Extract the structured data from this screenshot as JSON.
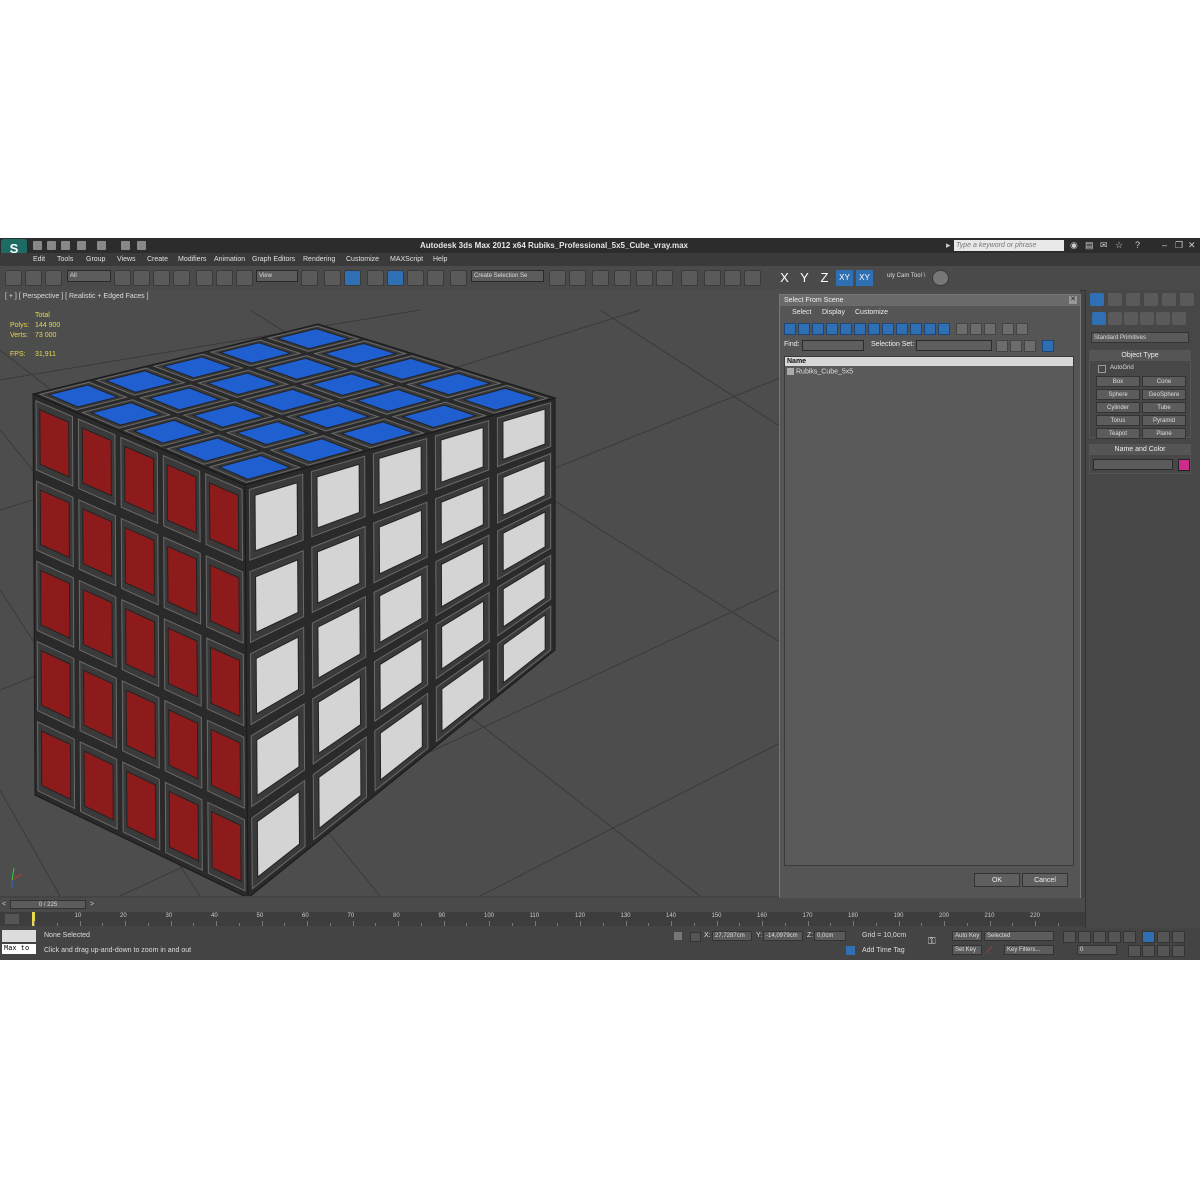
{
  "app": {
    "logo_text": "S",
    "title": "Autodesk 3ds Max  2012 x64     Rubiks_Professional_5x5_Cube_vray.max",
    "search_placeholder": "Type a keyword or phrase"
  },
  "menu": [
    "Edit",
    "Tools",
    "Group",
    "Views",
    "Create",
    "Modifiers",
    "Animation",
    "Graph Editors",
    "Rendering",
    "Customize",
    "MAXScript",
    "Help"
  ],
  "toolbar": {
    "filter_value": "All",
    "ref_coord": "View",
    "selection_set_placeholder": "Create Selection Se",
    "axes": [
      "X",
      "Y",
      "Z",
      "XY",
      "XY"
    ],
    "cam_tool_label": "uty Cam Tool \\"
  },
  "viewport": {
    "label": "[ + ] [ Perspective ] [ Realistic + Edged Faces ]",
    "stats": {
      "total_label": "Total",
      "polys_label": "Polys:",
      "polys_value": "144 900",
      "verts_label": "Verts:",
      "verts_value": "73 000",
      "fps_label": "FPS:",
      "fps_value": "31,911"
    }
  },
  "dialog": {
    "title": "Select From Scene",
    "menu": [
      "Select",
      "Display",
      "Customize"
    ],
    "find_label": "Find:",
    "selection_set_label": "Selection Set:",
    "column_name": "Name",
    "items": [
      "Rubiks_Cube_5x5"
    ],
    "ok_label": "OK",
    "cancel_label": "Cancel"
  },
  "command_panel": {
    "category": "Standard Primitives",
    "object_type_title": "Object Type",
    "autogrid_label": "AutoGrid",
    "primitives": [
      "Box",
      "Cone",
      "Sphere",
      "GeoSphere",
      "Cylinder",
      "Tube",
      "Torus",
      "Pyramid",
      "Teapot",
      "Plane"
    ],
    "name_color_title": "Name and Color",
    "object_color": "#cc2d8a"
  },
  "timeline": {
    "slider_label": "0 / 225",
    "ticks": [
      "10",
      "20",
      "30",
      "40",
      "50",
      "60",
      "70",
      "80",
      "90",
      "100",
      "110",
      "120",
      "130",
      "140",
      "150",
      "160",
      "170",
      "180",
      "190",
      "200",
      "210",
      "220"
    ]
  },
  "status": {
    "maxscript_text": "Max to",
    "selection": "None Selected",
    "prompt": "Click and drag up-and-down to zoom in and out",
    "x_label": "X:",
    "x_value": "27,7287cm",
    "y_label": "Y:",
    "y_value": "-14,0979cm",
    "z_label": "Z:",
    "z_value": "0,0cm",
    "grid": "Grid = 10,0cm",
    "add_time_tag": "Add Time Tag",
    "auto_key": "Auto Key",
    "selected_dropdown": "Selected",
    "set_key": "Set Key",
    "key_filters": "Key Filters...",
    "frame_value": "0"
  },
  "colors": {
    "sticker_top": "#1f5fd0",
    "sticker_left": "#8e1b1b",
    "sticker_right": "#d4d4d4",
    "accent": "#2f6fb3"
  }
}
